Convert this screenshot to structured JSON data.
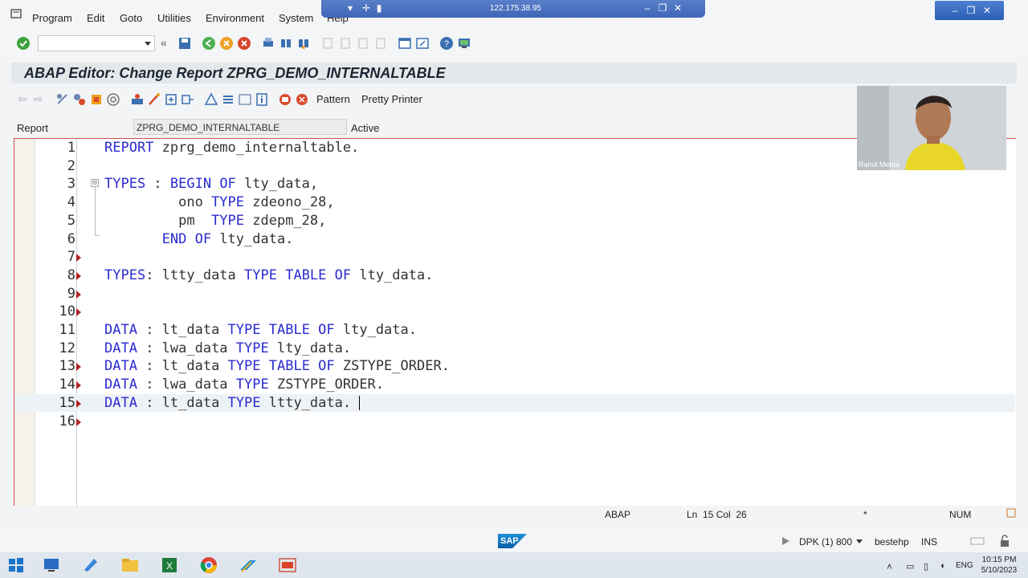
{
  "menubar": {
    "items": [
      "Program",
      "Edit",
      "Goto",
      "Utilities",
      "Environment",
      "System",
      "Help"
    ]
  },
  "remote": {
    "ip": "122.175.38.95"
  },
  "title": "ABAP Editor: Change Report ZPRG_DEMO_INTERNALTABLE",
  "app_toolbar": {
    "pattern_label": "Pattern",
    "pretty_printer_label": "Pretty Printer"
  },
  "report": {
    "label": "Report",
    "value": "ZPRG_DEMO_INTERNALTABLE",
    "status": "Active"
  },
  "editor": {
    "lines": [
      {
        "n": "1",
        "kw": "REPORT",
        "rest": " zprg_demo_internaltable."
      },
      {
        "n": "2",
        "kw": "",
        "rest": ""
      },
      {
        "n": "3",
        "kw": "TYPES",
        "rest": " : BEGIN OF lty_data,"
      },
      {
        "n": "4",
        "kw": "",
        "rest": "         ono TYPE zdeono_28,"
      },
      {
        "n": "5",
        "kw": "",
        "rest": "         pm  TYPE zdepm_28,"
      },
      {
        "n": "6",
        "kw": "",
        "rest": "       END OF lty_data."
      },
      {
        "n": "7",
        "kw": "",
        "rest": ""
      },
      {
        "n": "8",
        "kw": "TYPES",
        "rest": ": ltty_data TYPE TABLE OF lty_data."
      },
      {
        "n": "9",
        "kw": "",
        "rest": ""
      },
      {
        "n": "10",
        "kw": "",
        "rest": ""
      },
      {
        "n": "11",
        "kw": "DATA",
        "rest": " : lt_data TYPE TABLE OF lty_data."
      },
      {
        "n": "12",
        "kw": "DATA",
        "rest": " : lwa_data TYPE lty_data."
      },
      {
        "n": "13",
        "kw": "DATA",
        "rest": " : lt_data TYPE TABLE OF ZSTYPE_ORDER."
      },
      {
        "n": "14",
        "kw": "DATA",
        "rest": " : lwa_data TYPE ZSTYPE_ORDER."
      },
      {
        "n": "15",
        "kw": "DATA",
        "rest": " : lt_data TYPE ltty_data."
      },
      {
        "n": "16",
        "kw": "",
        "rest": ""
      }
    ]
  },
  "status": {
    "language": "ABAP",
    "position": "Ln  15 Col  26",
    "star": "*",
    "num": "NUM"
  },
  "bottom": {
    "system": "DPK (1) 800",
    "host": "bestehp",
    "mode": "INS"
  },
  "webcam": {
    "name": "Rahul Mehta"
  },
  "taskbar": {
    "lang": "ENG",
    "time": "10:15 PM",
    "date": "5/10/2023"
  },
  "colors": {
    "keyword": "#2a2ad0",
    "marker": "#b02424",
    "title_bg": "#e5e8eb"
  }
}
